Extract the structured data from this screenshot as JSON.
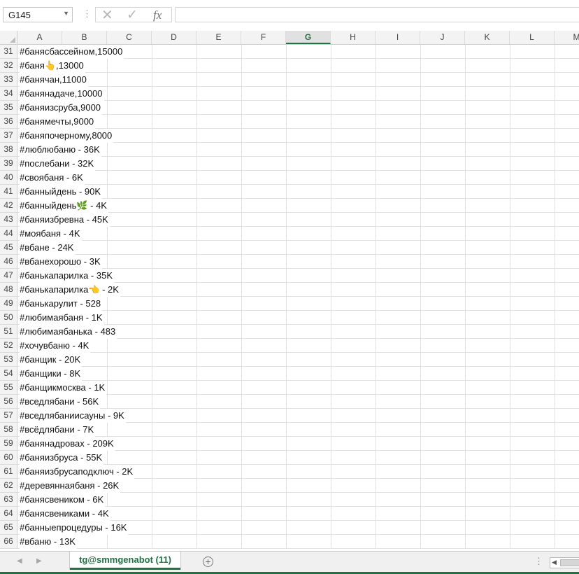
{
  "formula_bar": {
    "name_box": "G145",
    "separator": "⋮",
    "cancel_icon": "✕",
    "enter_icon": "✓",
    "fx_label": "fx",
    "formula_value": ""
  },
  "grid": {
    "columns": [
      "A",
      "B",
      "C",
      "D",
      "E",
      "F",
      "G",
      "H",
      "I",
      "J",
      "K",
      "L",
      "M"
    ],
    "selected_column": "G",
    "rows": [
      {
        "num": "31",
        "a": "#банясбассейном,15000"
      },
      {
        "num": "32",
        "a": "#баня👆,13000"
      },
      {
        "num": "33",
        "a": "#банячан,11000"
      },
      {
        "num": "34",
        "a": "#банянадаче,10000"
      },
      {
        "num": "35",
        "a": "#баняизсруба,9000"
      },
      {
        "num": "36",
        "a": "#банямечты,9000"
      },
      {
        "num": "37",
        "a": "#баняпочерному,8000"
      },
      {
        "num": "38",
        "a": "#люблюбаню - 36K"
      },
      {
        "num": "39",
        "a": "#послебани - 32K"
      },
      {
        "num": "40",
        "a": "#своябаня - 6K"
      },
      {
        "num": "41",
        "a": "#банныйдень - 90K"
      },
      {
        "num": "42",
        "a": "#банныйдень🌿 - 4K"
      },
      {
        "num": "43",
        "a": "#баняизбревна - 45K"
      },
      {
        "num": "44",
        "a": "#моябаня - 4K"
      },
      {
        "num": "45",
        "a": "#вбане - 24K"
      },
      {
        "num": "46",
        "a": "#вбанехорошо - 3K"
      },
      {
        "num": "47",
        "a": "#банькапарилка - 35K"
      },
      {
        "num": "48",
        "a": "#банькапарилка👈 - 2K"
      },
      {
        "num": "49",
        "a": "#банькарулит - 528"
      },
      {
        "num": "50",
        "a": "#любимаябаня - 1K"
      },
      {
        "num": "51",
        "a": "#любимаябанька - 483"
      },
      {
        "num": "52",
        "a": "#хочувбаню - 4K"
      },
      {
        "num": "53",
        "a": "#банщик - 20K"
      },
      {
        "num": "54",
        "a": "#банщики - 8K"
      },
      {
        "num": "55",
        "a": "#банщикмосква - 1K"
      },
      {
        "num": "56",
        "a": "#вседлябани - 56K"
      },
      {
        "num": "57",
        "a": "#вседлябаниисауны - 9K"
      },
      {
        "num": "58",
        "a": "#всёдлябани - 7K"
      },
      {
        "num": "59",
        "a": "#банянадровах - 209K"
      },
      {
        "num": "60",
        "a": "#баняизбруса - 55K"
      },
      {
        "num": "61",
        "a": "#баняизбрусаподключ - 2K"
      },
      {
        "num": "62",
        "a": "#деревяннаябаня - 26K"
      },
      {
        "num": "63",
        "a": "#банясвеником - 6K"
      },
      {
        "num": "64",
        "a": "#банясвениками - 4K"
      },
      {
        "num": "65",
        "a": "#банныепроцедуры - 16K"
      },
      {
        "num": "66",
        "a": "#вбаню - 13K"
      }
    ]
  },
  "sheet_tabs": {
    "prev_icon": "◀",
    "next_icon": "▶",
    "active_tab": "tg@smmgenabot (11)",
    "add_icon": "+",
    "split_icon": "⋮",
    "scroll_left_icon": "◀"
  },
  "colors": {
    "accent": "#217346",
    "header_bg": "#f3f3f3",
    "gridline": "#dfdfdf"
  }
}
